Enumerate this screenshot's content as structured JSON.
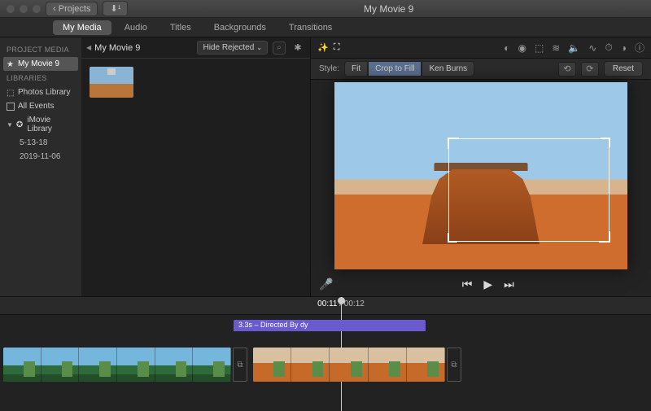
{
  "titlebar": {
    "back_label": "Projects",
    "app_title": "My Movie 9"
  },
  "tabs": {
    "items": [
      "My Media",
      "Audio",
      "Titles",
      "Backgrounds",
      "Transitions"
    ],
    "active_index": 0
  },
  "sidebar": {
    "sections": {
      "project_media": "Project Media",
      "libraries": "Libraries"
    },
    "project": "My Movie 9",
    "library_items": {
      "photos": "Photos Library",
      "all_events": "All Events",
      "imovie": "iMovie Library",
      "event1": "5-13-18",
      "event2": "2019-11-06"
    }
  },
  "browser": {
    "crumb": "My Movie 9",
    "filter": "Hide Rejected"
  },
  "viewer": {
    "style_label": "Style:",
    "fit": "Fit",
    "crop_to_fill": "Crop to Fill",
    "ken_burns": "Ken Burns",
    "reset": "Reset"
  },
  "timeline": {
    "current_time": "00:11",
    "total_time": "00:12",
    "clip_label": "3.3s – Directed By dy"
  }
}
